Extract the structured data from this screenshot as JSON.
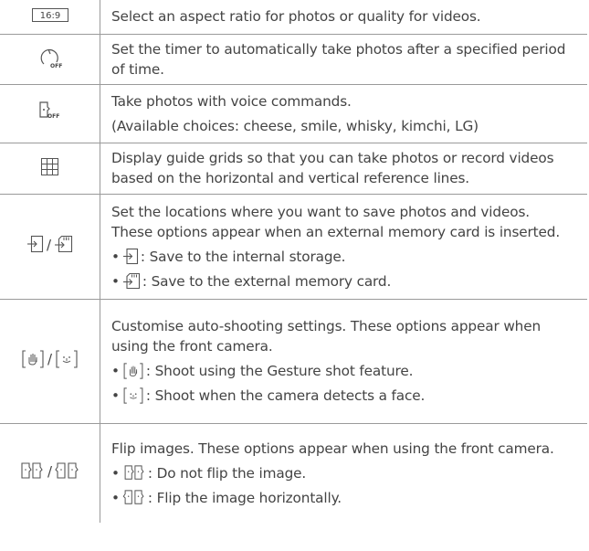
{
  "rows": [
    {
      "icon_label": "16:9",
      "icon": "aspect-ratio-icon",
      "lines": [
        "Select an aspect ratio for photos or quality for videos."
      ]
    },
    {
      "icon": "timer-off-icon",
      "icon_label": "OFF",
      "lines": [
        "Set the timer to automatically take photos after a specified period",
        "of time."
      ]
    },
    {
      "icon": "voice-shutter-off-icon",
      "icon_label": "OFF",
      "lines": [
        "Take photos with voice commands.",
        "(Available choices: cheese, smile, whisky, kimchi, LG)"
      ]
    },
    {
      "icon": "grid-icon",
      "lines": [
        "Display guide grids so that you can take photos or record videos",
        "based on the horizontal and vertical reference lines."
      ]
    },
    {
      "icon": "internal-external-storage-icon",
      "separator": "/",
      "lines": [
        "Set the locations where you want to save photos and videos.",
        "These options appear when an external memory card is inserted."
      ],
      "bullets": [
        {
          "icon": "internal-storage-icon",
          "text": ": Save to the internal storage."
        },
        {
          "icon": "external-memory-card-icon",
          "text": ": Save to the external memory card."
        }
      ]
    },
    {
      "icon": "gesture-face-shot-icon",
      "separator": "/",
      "lines": [
        "Customise auto-shooting settings. These options appear when",
        "using the front camera."
      ],
      "bullets": [
        {
          "icon": "gesture-shot-icon",
          "text": ": Shoot using the Gesture shot feature."
        },
        {
          "icon": "face-detect-icon",
          "text": ": Shoot when the camera detects a face."
        }
      ]
    },
    {
      "icon": "flip-images-icon",
      "separator": "/",
      "lines": [
        "Flip images. These options appear when using the front camera."
      ],
      "bullets": [
        {
          "icon": "no-flip-icon",
          "text": ": Do not flip the image."
        },
        {
          "icon": "flip-horizontal-icon",
          "text": ": Flip the image horizontally."
        }
      ]
    }
  ],
  "bullet_char": "•",
  "colors": {
    "text": "#444444",
    "border": "#9a9a9a",
    "icon": "#555555"
  }
}
